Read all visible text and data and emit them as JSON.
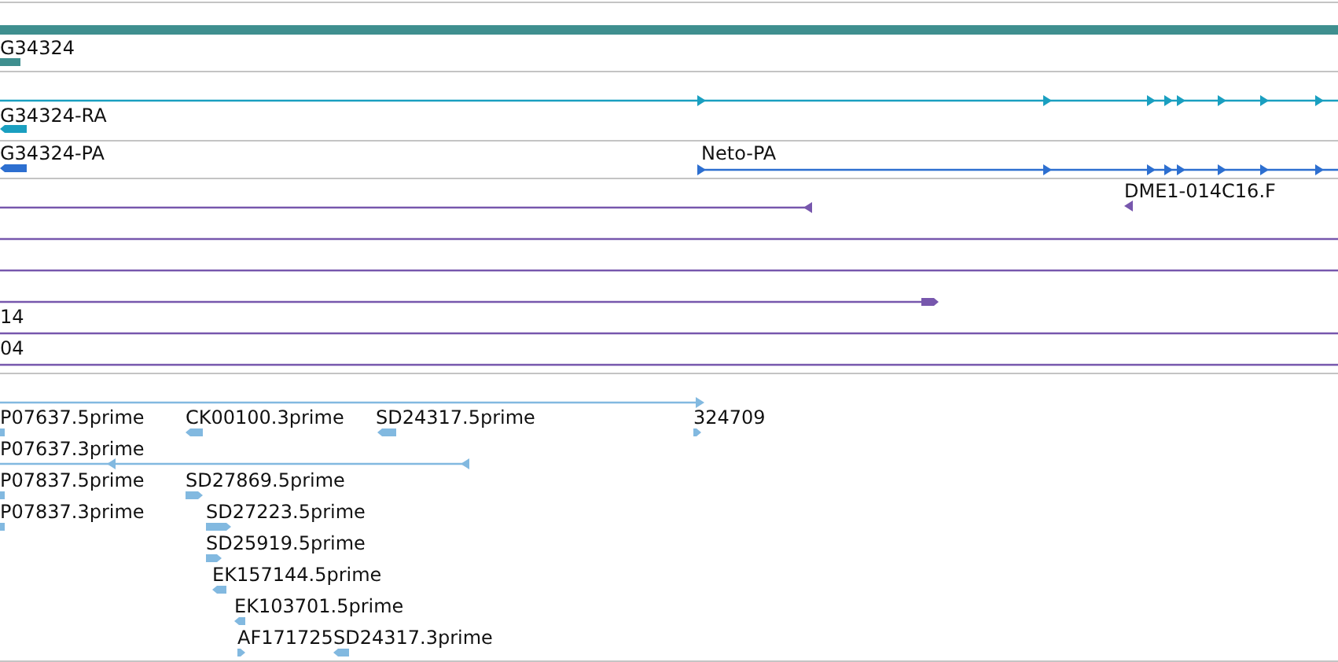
{
  "tracks": [
    {
      "kind": "gene",
      "labels": [
        "G34324"
      ]
    },
    {
      "kind": "transcript",
      "labels": [
        "G34324-RA"
      ]
    },
    {
      "kind": "protein",
      "labels": [
        "G34324-PA",
        "Neto-PA"
      ]
    },
    {
      "kind": "alignment",
      "labels": [
        "DME1-014C16.F",
        "14",
        "04"
      ]
    },
    {
      "kind": "est",
      "labels": [
        "P07637.5prime",
        "CK00100.3prime",
        "SD24317.5prime",
        "324709",
        "P07637.3prime",
        "P07837.5prime",
        "SD27869.5prime",
        "P07837.3prime",
        "SD27223.5prime",
        "SD25919.5prime",
        "EK157144.5prime",
        "EK103701.5prime",
        "AF171725",
        "SD24317.3prime"
      ]
    }
  ]
}
